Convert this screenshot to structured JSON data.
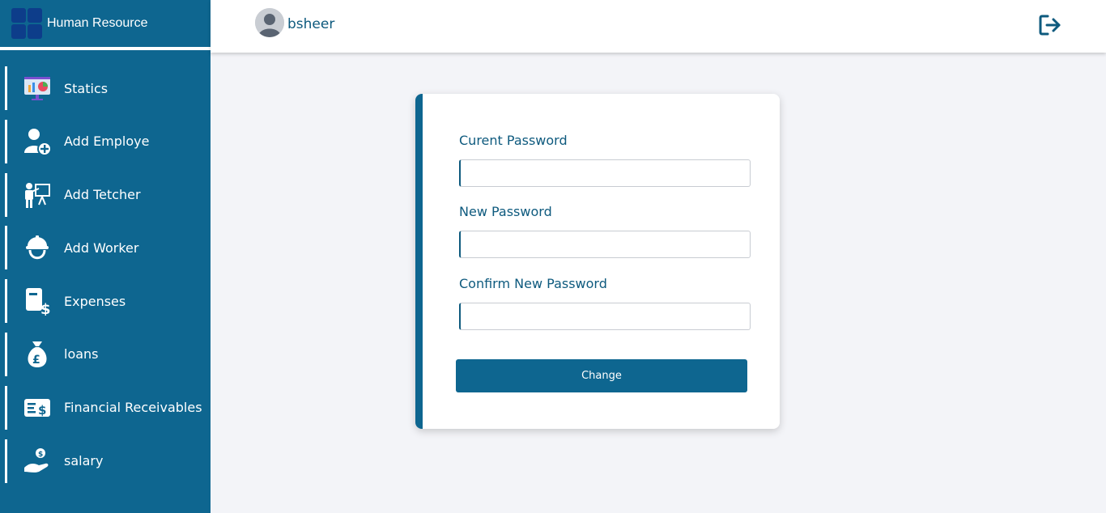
{
  "app": {
    "title": "Human Resource"
  },
  "user": {
    "name": "bsheer"
  },
  "sidebar": {
    "items": [
      {
        "label": "Statics",
        "icon": "statistics-icon"
      },
      {
        "label": "Add Employe",
        "icon": "add-user-icon"
      },
      {
        "label": "Add Tetcher",
        "icon": "teacher-icon"
      },
      {
        "label": "Add Worker",
        "icon": "worker-helmet-icon"
      },
      {
        "label": "Expenses",
        "icon": "expenses-icon"
      },
      {
        "label": "loans",
        "icon": "money-bag-icon"
      },
      {
        "label": "Financial Receivables",
        "icon": "receivables-icon"
      },
      {
        "label": "salary",
        "icon": "salary-hand-icon"
      }
    ]
  },
  "form": {
    "current_password_label": "Curent Password",
    "current_password_value": "",
    "new_password_label": "New Password",
    "new_password_value": "",
    "confirm_password_label": "Confirm New Password",
    "confirm_password_value": "",
    "submit_label": "Change"
  },
  "colors": {
    "primary": "#0e6690",
    "background": "#f3f4f8",
    "text_accent": "#0e5a7e"
  }
}
